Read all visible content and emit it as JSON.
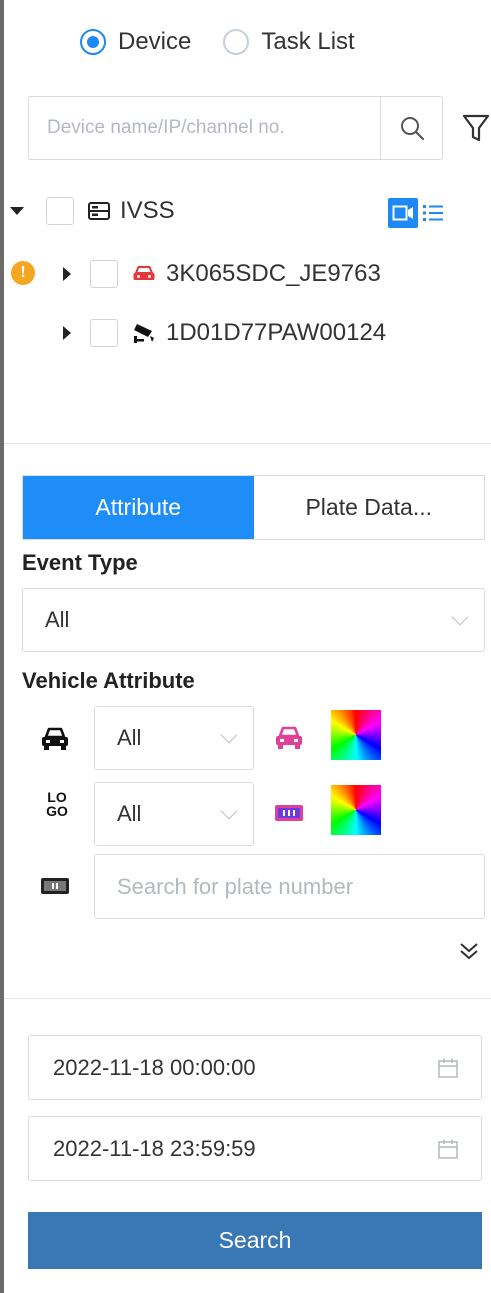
{
  "mode_radio": {
    "device_label": "Device",
    "task_list_label": "Task List",
    "selected": "Device"
  },
  "search": {
    "placeholder": "Device name/IP/channel no.",
    "value": ""
  },
  "tree": {
    "root": {
      "label": "IVSS",
      "expanded": true
    },
    "children": [
      {
        "label": "3K065SDC_JE9763",
        "icon": "vehicle-camera-icon",
        "icon_color": "#e5383b",
        "warning": "!"
      },
      {
        "label": "1D01D77PAW00124",
        "icon": "ptz-camera-icon",
        "icon_color": "#111111"
      }
    ]
  },
  "tabs": [
    {
      "label": "Attribute",
      "active": true
    },
    {
      "label": "Plate Data...",
      "active": false
    }
  ],
  "event_type": {
    "label": "Event Type",
    "selected": "All"
  },
  "vehicle_attribute": {
    "label": "Vehicle Attribute",
    "vehicle_type_selected": "All",
    "logo_selected": "All",
    "logo_icon_text": "LO GO",
    "plate_placeholder": "Search for plate number"
  },
  "time_range": {
    "start": "2022-11-18 00:00:00",
    "end": "2022-11-18 23:59:59"
  },
  "search_button_label": "Search",
  "colors": {
    "accent": "#1e88f5",
    "search_button": "#3a77b5",
    "warning": "#f5a623",
    "vehicle_icon_red": "#e5383b",
    "vehicle_color_icon": "#e0409a"
  }
}
